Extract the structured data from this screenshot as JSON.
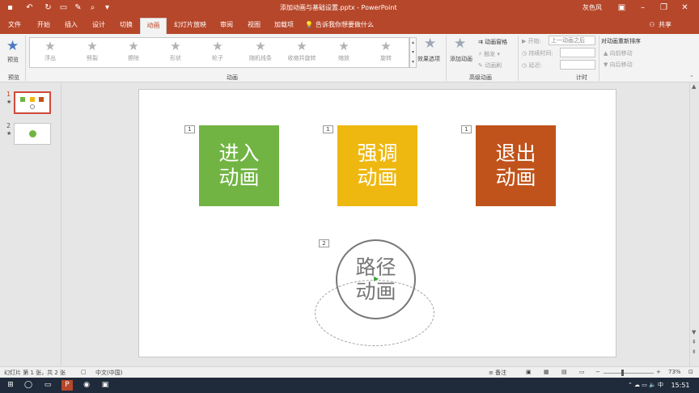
{
  "window": {
    "title": "添加动画与基础设置.pptx - PowerPoint",
    "user": "灰色风",
    "share": "共享",
    "accent": "#b7472a"
  },
  "tabs": [
    "文件",
    "开始",
    "插入",
    "设计",
    "切换",
    "动画",
    "幻灯片放映",
    "审阅",
    "视图",
    "加载项"
  ],
  "tell_me": "告诉我你想要做什么",
  "ribbon": {
    "preview_label": "预览",
    "group_preview": "预览",
    "group_animation": "动画",
    "group_advanced": "高级动画",
    "group_timing": "计时",
    "animations": [
      {
        "label": "浮出",
        "icon": "float-in-icon"
      },
      {
        "label": "劈裂",
        "icon": "split-icon"
      },
      {
        "label": "擦除",
        "icon": "wipe-icon"
      },
      {
        "label": "形状",
        "icon": "shape-icon"
      },
      {
        "label": "轮子",
        "icon": "wheel-icon"
      },
      {
        "label": "随机线条",
        "icon": "random-bars-icon"
      },
      {
        "label": "收缩并旋转",
        "icon": "shrink-turn-icon"
      },
      {
        "label": "缩放",
        "icon": "zoom-icon"
      },
      {
        "label": "旋转",
        "icon": "swivel-icon"
      }
    ],
    "effect_options": "效果选项",
    "add_animation": "添加动画",
    "animation_pane": "动画窗格",
    "trigger": "触发",
    "animation_painter": "动画刷",
    "start_label": "开始:",
    "start_value": "上一动画之后",
    "duration_label": "持续时间:",
    "delay_label": "延迟:",
    "reorder_title": "对动画重新排序",
    "move_earlier": "向前移动",
    "move_later": "向后移动"
  },
  "slides": [
    {
      "number": "1",
      "star": "★"
    },
    {
      "number": "2",
      "star": "★"
    }
  ],
  "slide": {
    "boxes": [
      {
        "text": "进入动画",
        "color": "#71b443",
        "tag": "1"
      },
      {
        "text": "强调动画",
        "color": "#eeb810",
        "tag": "1"
      },
      {
        "text": "退出动画",
        "color": "#c0531b",
        "tag": "1"
      }
    ],
    "circle": {
      "text": "路径动画",
      "tag": "2"
    }
  },
  "status": {
    "slide_info": "幻灯片 第 1 张，共 2 张",
    "language": "中文(中国)",
    "notes": "备注",
    "zoom": "73%"
  },
  "taskbar": {
    "time": "15:51"
  }
}
